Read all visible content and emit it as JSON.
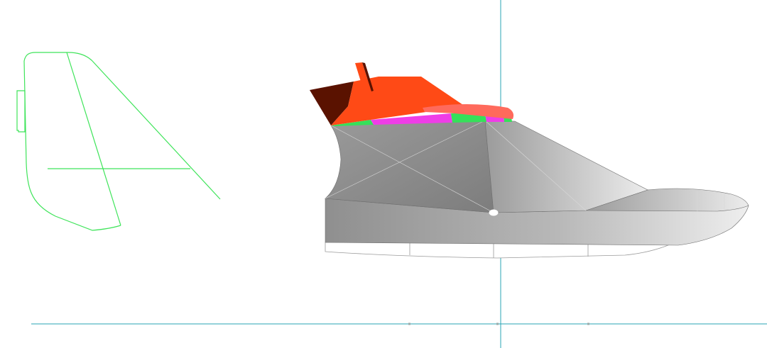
{
  "viewport": {
    "background": "#ffffff",
    "view": "side-elevation"
  },
  "colors": {
    "axis": "#2aa6b4",
    "wireframe": "#3fe45a",
    "hull_dark": "#8a8a8a",
    "hull_mid": "#a9a9a9",
    "hull_light": "#d8d8d8",
    "hull_outline": "#6f6f6f",
    "deck_red": "#ff4a16",
    "deck_dark": "#5a1200",
    "deck_salmon": "#ff6a5c",
    "panel_green": "#36e05a",
    "panel_magenta": "#ef3de7",
    "waterline_fill": "#ffffff",
    "waterline_stroke": "#9a9a9a"
  },
  "icons": {
    "origin_marker": "origin-marker-icon"
  }
}
